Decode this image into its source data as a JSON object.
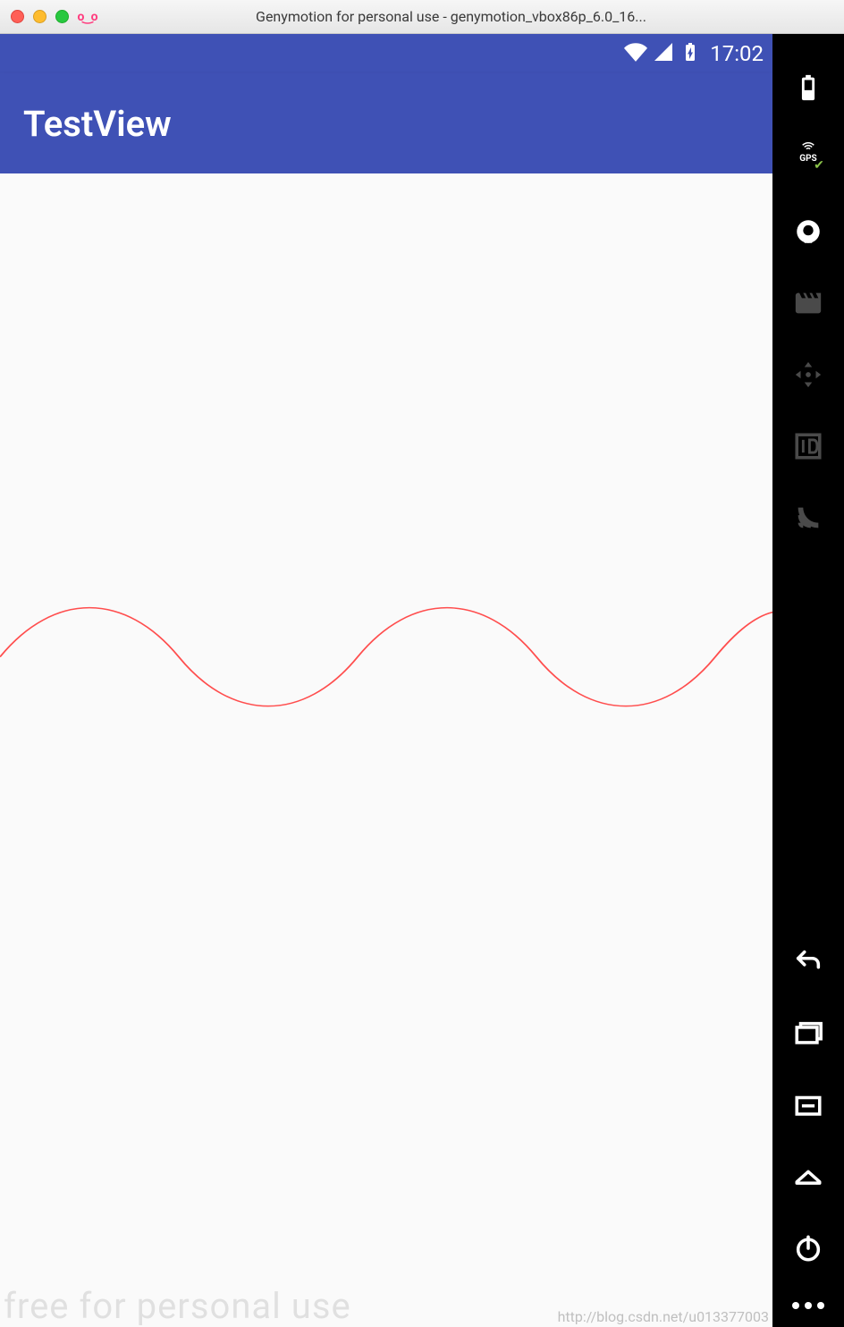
{
  "window": {
    "title": "Genymotion for personal use - genymotion_vbox86p_6.0_16..."
  },
  "status_bar": {
    "time": "17:02"
  },
  "app_bar": {
    "title": "TestView"
  },
  "watermark": {
    "left": "free for personal use",
    "right": "http://blog.csdn.net/u013377003"
  },
  "side_toolbar": {
    "battery": "battery",
    "gps": "GPS",
    "webcam": "webcam",
    "record": "screen-record",
    "dpad": "remote-control",
    "identifiers": "identifiers",
    "network": "network",
    "back": "back",
    "recent": "recent-apps",
    "menu": "menu",
    "home": "home",
    "power": "power",
    "more": "more"
  },
  "colors": {
    "primary": "#3f51b5",
    "wave": "#ff4d4d"
  }
}
